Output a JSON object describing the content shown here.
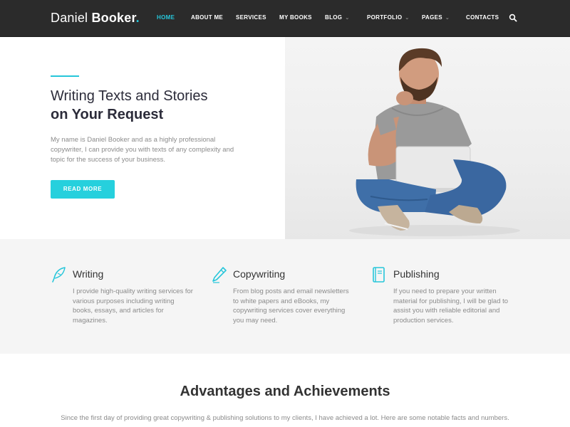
{
  "brand": {
    "first": "Daniel",
    "last": "Booker",
    "dot": "."
  },
  "nav": {
    "items": [
      {
        "label": "HOME"
      },
      {
        "label": "ABOUT ME"
      },
      {
        "label": "SERVICES"
      },
      {
        "label": "MY BOOKS"
      },
      {
        "label": "BLOG",
        "dropdown": true
      },
      {
        "label": "PORTFOLIO",
        "dropdown": true
      },
      {
        "label": "PAGES",
        "dropdown": true
      },
      {
        "label": "CONTACTS"
      }
    ],
    "active": "HOME",
    "search_icon": "search-icon"
  },
  "hero": {
    "title_line1": "Writing Texts and Stories",
    "title_line2": "on Your Request",
    "text": "My name is Daniel Booker and as a highly professional copywriter, I can provide you with texts of any complexity and topic for the success of your business.",
    "button": "READ MORE"
  },
  "services": [
    {
      "icon": "feather-quill-icon",
      "title": "Writing",
      "text": "I provide high-quality writing services for various purposes including writing books, essays, and articles for magazines."
    },
    {
      "icon": "pen-icon",
      "title": "Copywriting",
      "text": "From blog posts and email newsletters to white papers and eBooks, my copywriting services cover everything you may need."
    },
    {
      "icon": "book-icon",
      "title": "Publishing",
      "text": "If you need to prepare your written material for publishing, I will be glad to assist you with reliable editorial and production services."
    }
  ],
  "advantages": {
    "title": "Advantages and Achievements",
    "text": "Since the first day of providing great copywriting & publishing solutions to my clients, I have achieved a lot. Here are some notable facts and numbers."
  },
  "colors": {
    "accent": "#26c6da",
    "header_bg": "#2b2b2b",
    "services_bg": "#f5f5f5"
  }
}
